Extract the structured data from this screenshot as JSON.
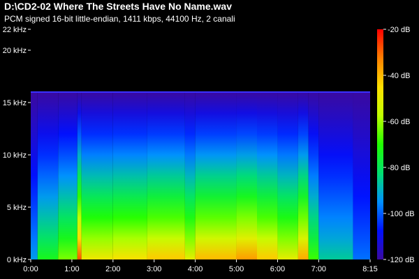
{
  "window": {
    "title": "D:\\CD2-02 Where The Streets Have No Name.wav",
    "subtitle": "PCM signed 16-bit little-endian, 1411 kbps, 44100 Hz, 2 canali"
  },
  "colors": {
    "background": "#000000",
    "text": "#ffffff",
    "colormap": [
      "#3a0aa0",
      "#0010ff",
      "#0090ff",
      "#00e070",
      "#20ff00",
      "#c0ff00",
      "#ffe000",
      "#ff8000",
      "#ff0000"
    ]
  },
  "chart_data": {
    "type": "heatmap",
    "title": "D:\\CD2-02 Where The Streets Have No Name.wav",
    "subtitle": "PCM signed 16-bit little-endian, 1411 kbps, 44100 Hz, 2 canali",
    "x_ticks": [
      "0:00",
      "1:00",
      "2:00",
      "3:00",
      "4:00",
      "5:00",
      "6:00",
      "7:00",
      "8:15"
    ],
    "x_tick_seconds": [
      0,
      60,
      120,
      180,
      240,
      300,
      360,
      420,
      495
    ],
    "xlim": [
      0,
      495
    ],
    "y_ticks": [
      "0 kHz",
      "5 kHz",
      "10 kHz",
      "15 kHz",
      "20 kHz",
      "22 kHz"
    ],
    "y_tick_khz": [
      0,
      5,
      10,
      15,
      20,
      22
    ],
    "ylim": [
      0,
      22
    ],
    "colorbar_ticks": [
      "-20 dB",
      "-40 dB",
      "-60 dB",
      "-80 dB",
      "-100 dB",
      "-120 dB"
    ],
    "colorbar_db": [
      -20,
      -40,
      -60,
      -80,
      -100,
      -120
    ],
    "colorbar_range": [
      -120,
      -20
    ],
    "cutoff_khz": 16,
    "segments": [
      {
        "start": 0,
        "end": 10,
        "level": 0.15
      },
      {
        "start": 10,
        "end": 40,
        "level": 0.35
      },
      {
        "start": 40,
        "end": 68,
        "level": 0.45
      },
      {
        "start": 68,
        "end": 74,
        "level": 0.8
      },
      {
        "start": 74,
        "end": 120,
        "level": 0.6
      },
      {
        "start": 120,
        "end": 170,
        "level": 0.62
      },
      {
        "start": 170,
        "end": 225,
        "level": 0.66
      },
      {
        "start": 225,
        "end": 240,
        "level": 0.58
      },
      {
        "start": 240,
        "end": 300,
        "level": 0.68
      },
      {
        "start": 300,
        "end": 330,
        "level": 0.72
      },
      {
        "start": 330,
        "end": 360,
        "level": 0.66
      },
      {
        "start": 360,
        "end": 390,
        "level": 0.58
      },
      {
        "start": 390,
        "end": 405,
        "level": 0.7
      },
      {
        "start": 405,
        "end": 420,
        "level": 0.4
      },
      {
        "start": 420,
        "end": 470,
        "level": 0.22
      },
      {
        "start": 470,
        "end": 495,
        "level": 0.1
      }
    ]
  }
}
